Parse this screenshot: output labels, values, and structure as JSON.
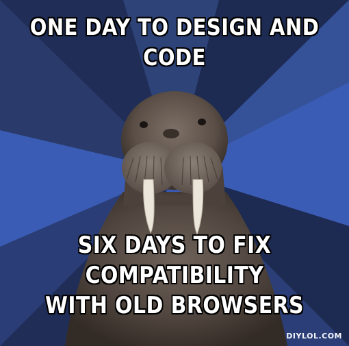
{
  "meme": {
    "top_lines": [
      "ONE DAY TO DESIGN AND",
      "CODE"
    ],
    "bottom_lines": [
      "SIX DAYS TO FIX COMPATIBILITY",
      "WITH OLD BROWSERS"
    ],
    "watermark": "DIYLOL.COM"
  },
  "colors": {
    "ray_dark": "#1d2a52",
    "ray_mid": "#2c3c6e",
    "ray_light": "#3b5cb4",
    "text": "#ffffff",
    "outline": "#000000"
  },
  "icons": [
    "walrus-image"
  ]
}
